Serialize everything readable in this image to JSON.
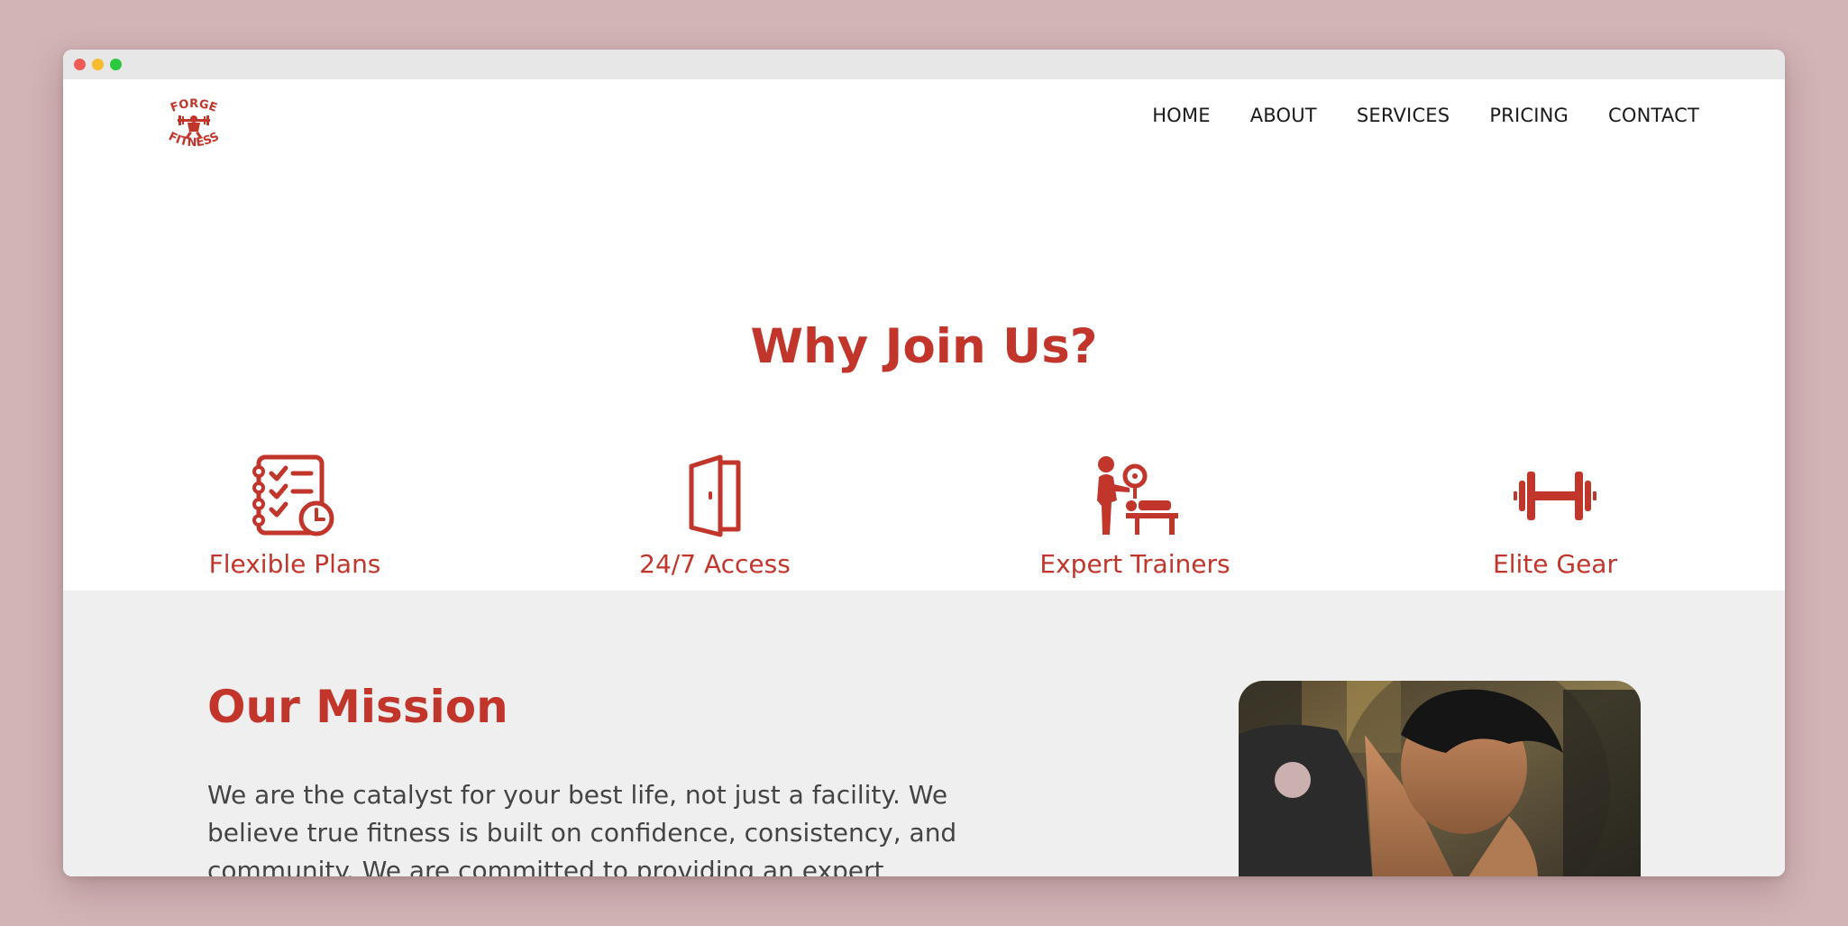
{
  "window": {
    "controls": [
      "close",
      "minimize",
      "maximize"
    ]
  },
  "brand": {
    "logo_top_text": "FORGE",
    "logo_bottom_text": "FITNESS",
    "color": "#c2352b"
  },
  "nav": {
    "items": [
      {
        "label": "HOME"
      },
      {
        "label": "ABOUT"
      },
      {
        "label": "SERVICES"
      },
      {
        "label": "PRICING"
      },
      {
        "label": "CONTACT"
      }
    ]
  },
  "why": {
    "title": "Why Join Us?",
    "features": [
      {
        "label": "Flexible Plans",
        "icon": "checklist-clock-icon"
      },
      {
        "label": "24/7 Access",
        "icon": "door-icon"
      },
      {
        "label": "Expert Trainers",
        "icon": "trainer-bench-icon"
      },
      {
        "label": "Elite Gear",
        "icon": "dumbbell-icon"
      }
    ]
  },
  "mission": {
    "title": "Our Mission",
    "text": "We are the catalyst for your best life, not just a facility. We believe true fitness is built on confidence, consistency, and community. We are committed to providing an expert guidance"
  },
  "colors": {
    "accent": "#c2352b",
    "background": "#d2b4b6",
    "section_gray": "#efefef"
  }
}
